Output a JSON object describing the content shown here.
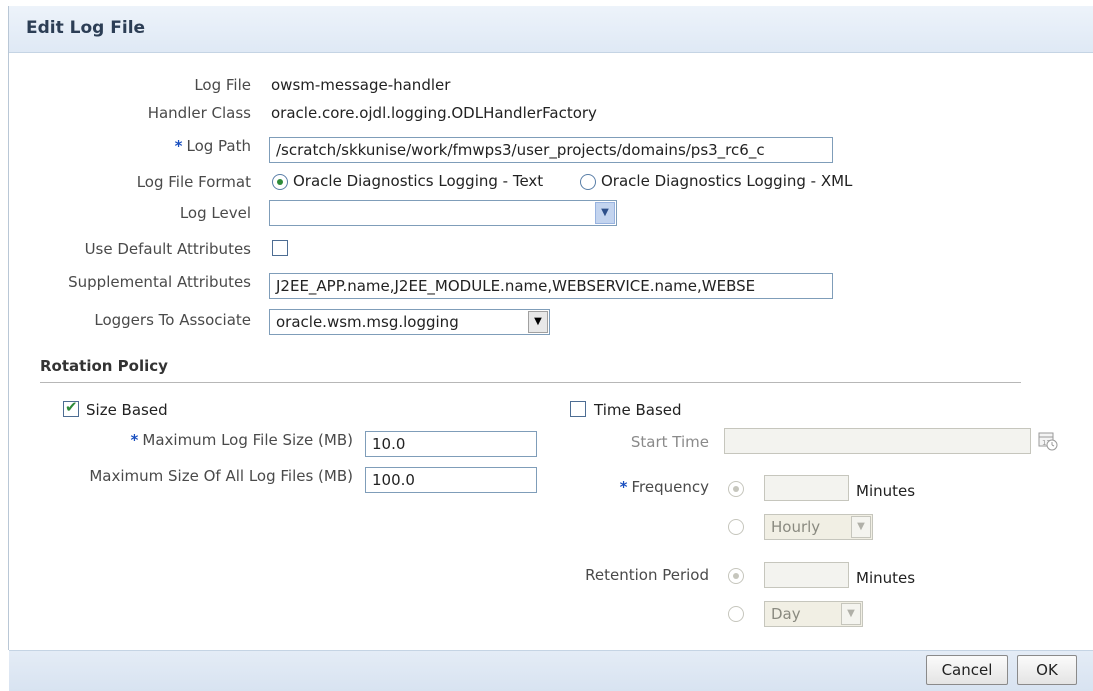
{
  "dialog": {
    "title": "Edit Log File"
  },
  "form": {
    "log_file": {
      "label": "Log File",
      "value": "owsm-message-handler"
    },
    "handler_class": {
      "label": "Handler Class",
      "value": "oracle.core.ojdl.logging.ODLHandlerFactory"
    },
    "log_path": {
      "label": "Log Path",
      "required_marker": "*",
      "value": "/scratch/skkunise/work/fmwps3/user_projects/domains/ps3_rc6_c"
    },
    "log_file_format": {
      "label": "Log File Format",
      "options": [
        "Oracle Diagnostics Logging - Text",
        "Oracle Diagnostics Logging - XML"
      ],
      "selected": "Oracle Diagnostics Logging - Text"
    },
    "log_level": {
      "label": "Log Level",
      "value": ""
    },
    "use_default_attributes": {
      "label": "Use Default Attributes",
      "checked": false
    },
    "supplemental_attributes": {
      "label": "Supplemental Attributes",
      "value": "J2EE_APP.name,J2EE_MODULE.name,WEBSERVICE.name,WEBSE"
    },
    "loggers_to_associate": {
      "label": "Loggers To Associate",
      "value": "oracle.wsm.msg.logging"
    }
  },
  "rotation_policy": {
    "title": "Rotation Policy",
    "size_based": {
      "label": "Size Based",
      "checked": true,
      "max_log_file_size": {
        "label": "Maximum Log File Size (MB)",
        "required_marker": "*",
        "value": "10.0"
      },
      "max_size_all_files": {
        "label": "Maximum Size Of All Log Files (MB)",
        "value": "100.0"
      }
    },
    "time_based": {
      "label": "Time Based",
      "checked": false,
      "start_time": {
        "label": "Start Time",
        "value": ""
      },
      "frequency": {
        "label": "Frequency",
        "required_marker": "*",
        "minutes_value": "",
        "minutes_unit": "Minutes",
        "interval_value": "Hourly"
      },
      "retention_period": {
        "label": "Retention Period",
        "minutes_value": "",
        "minutes_unit": "Minutes",
        "interval_value": "Day"
      }
    }
  },
  "footer": {
    "cancel_label": "Cancel",
    "ok_label": "OK"
  },
  "icons": {
    "calendar": "calendar-clock-icon",
    "dropdown": "chevron-down-icon",
    "check": "checkmark-icon"
  },
  "colors": {
    "accent_green": "#2e8b3a",
    "required_blue": "#1a4fbf",
    "header_bg": "#dfe9f5"
  }
}
